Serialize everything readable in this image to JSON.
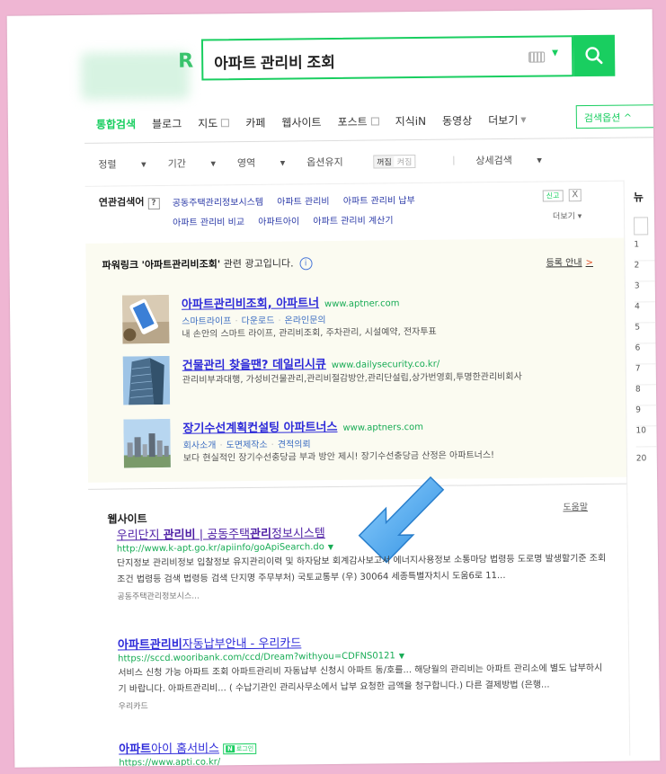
{
  "search": {
    "query": "아파트 관리비 조회",
    "logo_char": "R"
  },
  "tabs": [
    {
      "label": "통합검색",
      "active": true
    },
    {
      "label": "블로그"
    },
    {
      "label": "지도",
      "square": true
    },
    {
      "label": "카페"
    },
    {
      "label": "웹사이트"
    },
    {
      "label": "포스트",
      "square": true
    },
    {
      "label": "지식iN"
    },
    {
      "label": "동영상"
    },
    {
      "label": "더보기",
      "caret": true
    }
  ],
  "search_options_label": "검색옵션 ^",
  "filters": {
    "sort": "정렬",
    "period": "기간",
    "area": "영역",
    "original": "옵션유지",
    "on": "꺼짐",
    "off": "켜짐",
    "detail": "상세검색"
  },
  "related": {
    "title": "연관검색어",
    "help": "?",
    "links": [
      "공동주택관리정보시스템",
      "아파트 관리비",
      "아파트 관리비 납부",
      "아파트 관리비 비교",
      "아파트아이",
      "아파트 관리비 계산기"
    ],
    "report": "신고",
    "close": "X",
    "more": "더보기"
  },
  "powerlink": {
    "label": "파워링크",
    "keyword": "'아파트관리비조회'",
    "suffix": "관련 광고입니다.",
    "info": "i",
    "register": "등록 안내",
    "register_arrow": ">",
    "ads": [
      {
        "title": "아파트관리비조회, 아파트너",
        "url": "www.aptner.com",
        "links": [
          "스마트라이프",
          "다운로드",
          "온라인문의"
        ],
        "desc": "내 손안의 스마트 라이프, 관리비조회, 주차관리, 시설예약, 전자투표"
      },
      {
        "title": "건물관리 찾을땐? 데일리시큐",
        "url": "www.dailysecurity.co.kr/",
        "links": [],
        "desc": "관리비부과대행, 가성비건물관리,관리비절감방안,관리단설립,상가번영회,투명한관리비회사"
      },
      {
        "title": "장기수선계획컨설팅 아파트너스",
        "url": "www.aptners.com",
        "links": [
          "회사소개",
          "도면제작소",
          "견적의뢰"
        ],
        "desc": "보다 현실적인 장기수선충당금 부과 방안 제시! 장기수선충당금 산정은 아파트너스!"
      }
    ]
  },
  "website": {
    "title": "웹사이트",
    "help": "도움말",
    "results": [
      {
        "title_pre": "우리단지 ",
        "title_b1": "관리비",
        "title_mid": " | 공동주택",
        "title_b2": "관리",
        "title_post": "정보시스템",
        "url": "http://www.k-apt.go.kr/apiinfo/goApiSearch.do",
        "desc": "단지정보 관리비정보 입찰정보 유지관리이력 및 하자담보 회계감사보고서 에너지사용정보 소통마당 법령등 도로명 발생할기준 조회조건 법령등 검색 법령등 검색 단지명 주무부처) 국토교통부 (우) 30064 세종특별자치시 도움6로 11...",
        "source": "공동주택관리정보시스..."
      },
      {
        "title_pre": "아파트관리비",
        "title_post": "자동납부안내 - 우리카드",
        "url": "https://sccd.wooribank.com/ccd/Dream?withyou=CDFNS0121",
        "desc": "서비스 신청 가능 아파트 조회 아파트관리비 자동납부 신청시 아파트 동/호를... 해당월의 관리비는 아파트 관리소에 별도 납부하시기 바랍니다. 아파트관리비... ( 수납기관인 관리사무소에서 납부 요청한 금액을 청구합니다.) 다른 결제방법 (은행...",
        "source": "우리카드"
      },
      {
        "title_pre": "아파트",
        "title_post": "아이 홈서비스",
        "badge_n": "N",
        "badge": "로그인",
        "url": "https://www.apti.co.kr/"
      }
    ]
  },
  "sidebar": {
    "head": "뉴",
    "nums": [
      "1",
      "2",
      "3",
      "4",
      "5",
      "6",
      "7",
      "8",
      "9",
      "10"
    ],
    "footer": "20"
  },
  "colors": {
    "accent": "#19ce60",
    "link": "#2e2bd9",
    "visited": "#4e1fa5",
    "url": "#19ac56",
    "arrow": "#3aa0e8",
    "background": "#efb6d3"
  }
}
